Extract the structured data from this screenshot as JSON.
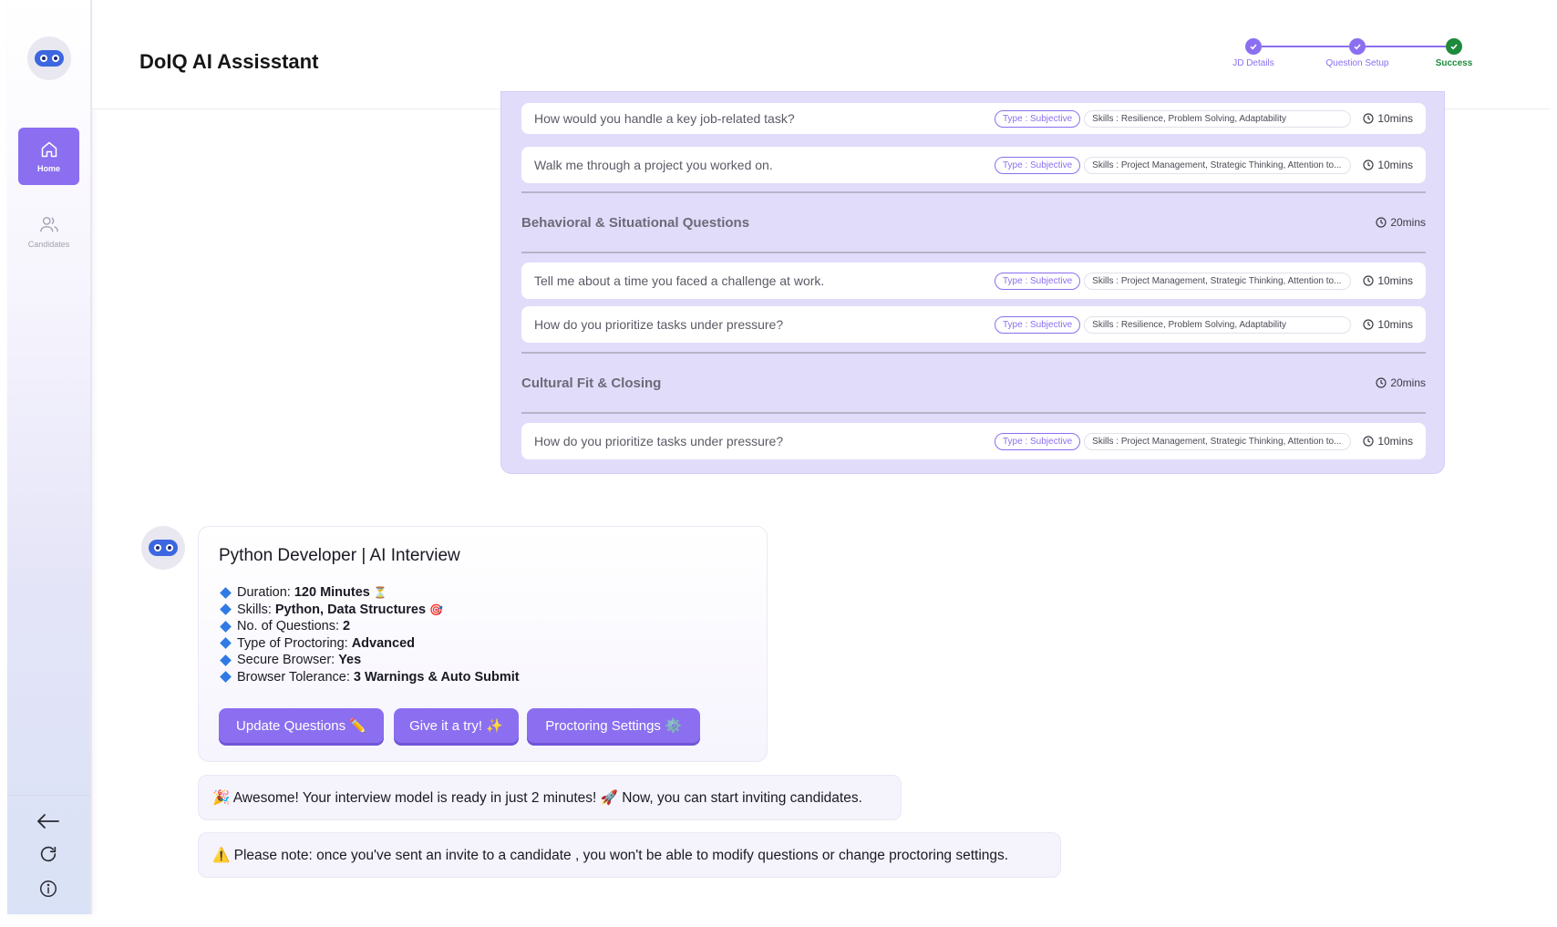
{
  "app": {
    "title": "DoIQ AI Assisstant"
  },
  "sidebar": {
    "home_label": "Home",
    "candidates_label": "Candidates"
  },
  "stepper": {
    "steps": [
      {
        "label": "JD Details",
        "status": "done"
      },
      {
        "label": "Question Setup",
        "status": "done"
      },
      {
        "label": "Success",
        "status": "success"
      }
    ]
  },
  "questions": {
    "type_label": "Type : Subjective",
    "rows_top": [
      {
        "text": "How would you handle a key job-related task?",
        "skills": "Skills : Resilience, Problem Solving, Adaptability",
        "time": "10mins"
      },
      {
        "text": "Walk me through a project you worked on.",
        "skills": "Skills : Project Management, Strategic Thinking, Attention to...",
        "time": "10mins"
      }
    ],
    "sections": [
      {
        "title": "Behavioral & Situational Questions",
        "time": "20mins",
        "rows": [
          {
            "text": "Tell me about a time you faced a challenge at work.",
            "skills": "Skills : Project Management, Strategic Thinking, Attention to...",
            "time": "10mins"
          },
          {
            "text": "How do you prioritize tasks under pressure?",
            "skills": "Skills : Resilience, Problem Solving, Adaptability",
            "time": "10mins"
          }
        ]
      },
      {
        "title": "Cultural Fit & Closing",
        "time": "20mins",
        "rows": [
          {
            "text": "How do you prioritize tasks under pressure?",
            "skills": "Skills : Project Management, Strategic Thinking, Attention to...",
            "time": "10mins"
          }
        ]
      }
    ]
  },
  "summary": {
    "title": "Python Developer | AI Interview",
    "details": [
      {
        "label": "Duration:",
        "value": "120 Minutes",
        "emoji": "⏳"
      },
      {
        "label": "Skills:",
        "value": "Python, Data Structures",
        "emoji": "🎯"
      },
      {
        "label": "No. of Questions:",
        "value": "2",
        "emoji": ""
      },
      {
        "label": "Type of Proctoring:",
        "value": "Advanced",
        "emoji": ""
      },
      {
        "label": "Secure Browser:",
        "value": "Yes",
        "emoji": ""
      },
      {
        "label": "Browser Tolerance:",
        "value": "3 Warnings & Auto Submit",
        "emoji": ""
      }
    ],
    "buttons": {
      "update": "Update Questions ✏️",
      "try": "Give it a try! ✨",
      "proctoring": "Proctoring Settings ⚙️"
    }
  },
  "messages": {
    "ready": "🎉 Awesome! Your interview model is ready in just 2 minutes! 🚀 Now, you can start inviting candidates.",
    "note": "⚠️ Please note: once you've sent an invite to a candidate , you won't be able to modify questions or change proctoring settings."
  },
  "colors": {
    "accent": "#8b6ff0",
    "success": "#1e8a3c",
    "panel": "#e2dcfb",
    "bot": "#3d67e0"
  }
}
